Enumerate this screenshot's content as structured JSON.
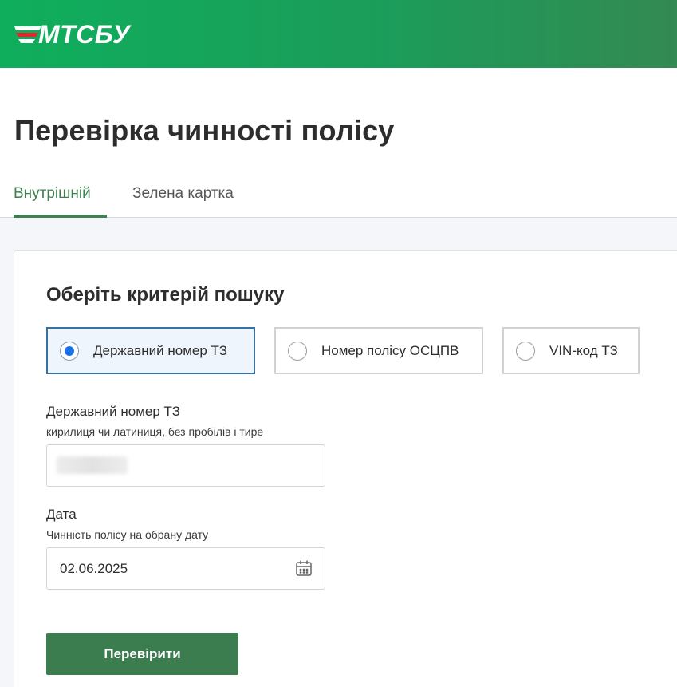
{
  "header": {
    "logo_text": "МТСБУ",
    "colors": {
      "gradient_start": "#0fae5c",
      "gradient_end": "#338a52",
      "logo_red": "#e0282d"
    }
  },
  "page": {
    "title": "Перевірка чинності полісу"
  },
  "tabs": [
    {
      "label": "Внутрішній",
      "active": true
    },
    {
      "label": "Зелена картка",
      "active": false
    }
  ],
  "form": {
    "criteria_title": "Оберіть критерій пошуку",
    "options": [
      {
        "label": "Державний номер ТЗ",
        "selected": true
      },
      {
        "label": "Номер полісу ОСЦПВ",
        "selected": false
      },
      {
        "label": "VIN-код ТЗ",
        "selected": false
      }
    ],
    "plate_field": {
      "label": "Державний номер ТЗ",
      "hint": "кирилиця чи латиниця, без пробілів і тире",
      "value": ""
    },
    "date_field": {
      "label": "Дата",
      "hint": "Чинність полісу на обрану дату",
      "value": "02.06.2025",
      "icon": "calendar-icon"
    },
    "submit_label": "Перевірити"
  },
  "colors": {
    "accent_green": "#3b7d4e",
    "tab_active": "#3e7f4f",
    "radio_selected": "#1a73e8"
  }
}
